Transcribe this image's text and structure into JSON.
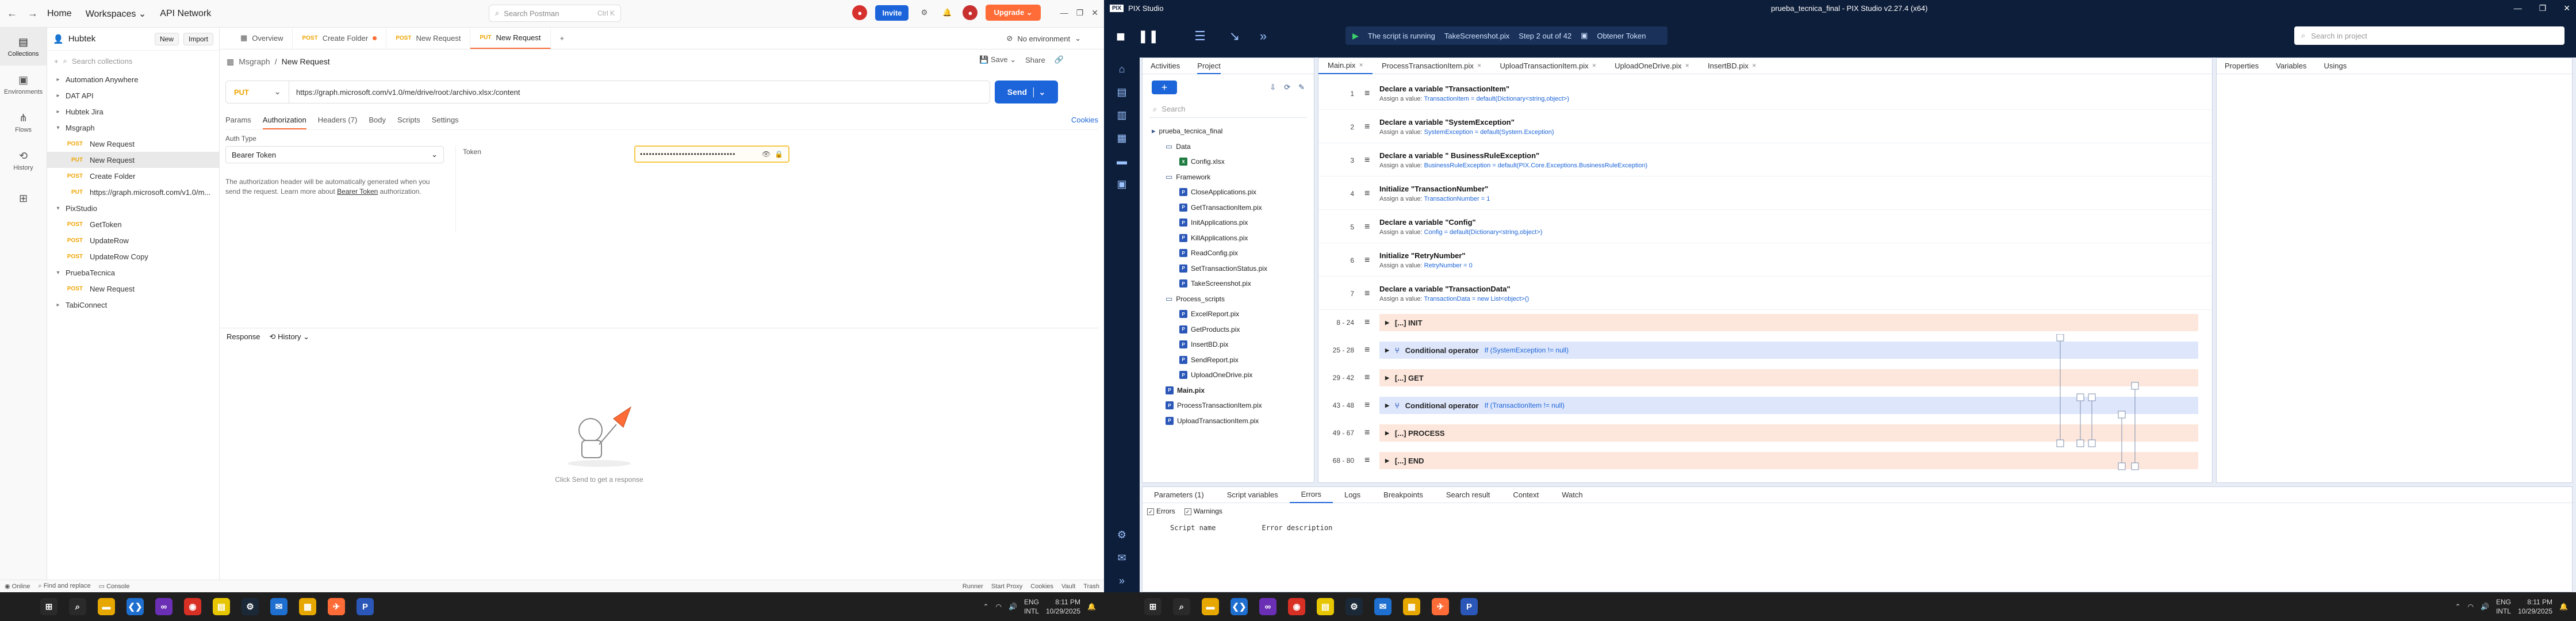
{
  "postman": {
    "topbar": {
      "home": "Home",
      "workspaces": "Workspaces",
      "api_network": "API Network",
      "search_placeholder": "Search Postman",
      "search_kbd": "Ctrl K",
      "invite": "Invite",
      "upgrade": "Upgrade"
    },
    "rail": [
      {
        "label": "Collections",
        "icon": "collections-icon"
      },
      {
        "label": "Environments",
        "icon": "environments-icon"
      },
      {
        "label": "Flows",
        "icon": "flows-icon"
      },
      {
        "label": "History",
        "icon": "history-icon"
      },
      {
        "label": "",
        "icon": "apps-icon"
      }
    ],
    "sidebar": {
      "workspace": "Hubtek",
      "new": "New",
      "import": "Import",
      "search_placeholder": "Search collections",
      "tree": [
        {
          "label": "Automation Anywhere",
          "level": 0,
          "type": "folder",
          "open": false
        },
        {
          "label": "DAT API",
          "level": 0,
          "type": "folder",
          "open": false
        },
        {
          "label": "Hubtek Jira",
          "level": 0,
          "type": "folder",
          "open": false
        },
        {
          "label": "Msgraph",
          "level": 0,
          "type": "folder",
          "open": true
        },
        {
          "label": "New Request",
          "level": 1,
          "type": "req",
          "method": "POST"
        },
        {
          "label": "New Request",
          "level": 1,
          "type": "req",
          "method": "PUT",
          "selected": true
        },
        {
          "label": "Create Folder",
          "level": 1,
          "type": "req",
          "method": "POST"
        },
        {
          "label": "https://graph.microsoft.com/v1.0/m...",
          "level": 1,
          "type": "req",
          "method": "PUT"
        },
        {
          "label": "PixStudio",
          "level": 0,
          "type": "folder",
          "open": true
        },
        {
          "label": "GetToken",
          "level": 1,
          "type": "req",
          "method": "POST"
        },
        {
          "label": "UpdateRow",
          "level": 1,
          "type": "req",
          "method": "POST"
        },
        {
          "label": "UpdateRow Copy",
          "level": 1,
          "type": "req",
          "method": "POST"
        },
        {
          "label": "PruebaTecnica",
          "level": 0,
          "type": "folder",
          "open": true
        },
        {
          "label": "New Request",
          "level": 1,
          "type": "req",
          "method": "POST"
        },
        {
          "label": "TabiConnect",
          "level": 0,
          "type": "folder",
          "open": false
        }
      ]
    },
    "tabs": [
      {
        "method": "",
        "label": "Overview"
      },
      {
        "method": "POST",
        "label": "Create Folder",
        "dot": true
      },
      {
        "method": "POST",
        "label": "New Request"
      },
      {
        "method": "PUT",
        "label": "New Request",
        "active": true
      }
    ],
    "env": "No environment",
    "breadcrumb": {
      "parent": "Msgraph",
      "current": "New Request"
    },
    "actions": {
      "save": "Save",
      "share": "Share"
    },
    "request": {
      "method": "PUT",
      "url": "https://graph.microsoft.com/v1.0/me/drive/root:/archivo.xlsx:/content",
      "send": "Send"
    },
    "req_tabs": [
      {
        "label": "Params"
      },
      {
        "label": "Authorization",
        "active": true
      },
      {
        "label": "Headers (7)"
      },
      {
        "label": "Body"
      },
      {
        "label": "Scripts"
      },
      {
        "label": "Settings"
      }
    ],
    "cookies": "Cookies",
    "auth": {
      "type_label": "Auth Type",
      "type_value": "Bearer Token",
      "help": "The authorization header will be automatically generated when you send the request. Learn more about ",
      "help_link": "Bearer Token",
      "help_end": " authorization.",
      "token_label": "Token",
      "token_value": "••••••••••••••••••••••••••••••••"
    },
    "response": {
      "label": "Response",
      "history": "History",
      "empty": "Click Send to get a response"
    },
    "statusbar": {
      "left": [
        "Online",
        "Find and replace",
        "Console"
      ],
      "right": [
        "Runner",
        "Start Proxy",
        "Cookies",
        "Vault",
        "Trash"
      ]
    }
  },
  "pix": {
    "title": "prueba_tecnica_final - PIX Studio v2.27.4 (x64)",
    "app_name": "PIX Studio",
    "run": {
      "status": "The script is running",
      "file": "TakeScreenshot.pix",
      "step": "Step 2 out of 42",
      "activity": "Obtener Token"
    },
    "search_placeholder": "Search in project",
    "project_tabs": [
      {
        "label": "Activities"
      },
      {
        "label": "Project",
        "active": true
      }
    ],
    "project_search": "Search",
    "project_tree": [
      {
        "label": "prueba_tecnica_final",
        "level": 0,
        "kind": "root"
      },
      {
        "label": "Data",
        "level": 1,
        "kind": "folder"
      },
      {
        "label": "Config.xlsx",
        "level": 2,
        "kind": "xls"
      },
      {
        "label": "Framework",
        "level": 1,
        "kind": "folder"
      },
      {
        "label": "CloseApplications.pix",
        "level": 2,
        "kind": "pix"
      },
      {
        "label": "GetTransactionItem.pix",
        "level": 2,
        "kind": "pix"
      },
      {
        "label": "InitApplications.pix",
        "level": 2,
        "kind": "pix"
      },
      {
        "label": "KillApplications.pix",
        "level": 2,
        "kind": "pix"
      },
      {
        "label": "ReadConfig.pix",
        "level": 2,
        "kind": "pix"
      },
      {
        "label": "SetTransactionStatus.pix",
        "level": 2,
        "kind": "pix"
      },
      {
        "label": "TakeScreenshot.pix",
        "level": 2,
        "kind": "pix"
      },
      {
        "label": "Process_scripts",
        "level": 1,
        "kind": "folder"
      },
      {
        "label": "ExcelReport.pix",
        "level": 2,
        "kind": "pix"
      },
      {
        "label": "GetProducts.pix",
        "level": 2,
        "kind": "pix"
      },
      {
        "label": "InsertBD.pix",
        "level": 2,
        "kind": "pix"
      },
      {
        "label": "SendReport.pix",
        "level": 2,
        "kind": "pix"
      },
      {
        "label": "UploadOneDrive.pix",
        "level": 2,
        "kind": "pix"
      },
      {
        "label": "Main.pix",
        "level": 1,
        "kind": "pix",
        "bold": true
      },
      {
        "label": "ProcessTransactionItem.pix",
        "level": 1,
        "kind": "pix"
      },
      {
        "label": "UploadTransactionItem.pix",
        "level": 1,
        "kind": "pix"
      }
    ],
    "editor_tabs": [
      {
        "label": "Main.pix",
        "active": true
      },
      {
        "label": "ProcessTransactionItem.pix"
      },
      {
        "label": "UploadTransactionItem.pix"
      },
      {
        "label": "UploadOneDrive.pix"
      },
      {
        "label": "InsertBD.pix"
      }
    ],
    "sequence": [
      {
        "kind": "var",
        "line": "1",
        "title": "Declare a variable \"TransactionItem\"",
        "prefix": "Assign a value: ",
        "value": "TransactionItem = default(Dictionary<string,object>)"
      },
      {
        "kind": "var",
        "line": "2",
        "title": "Declare a variable \"SystemException\"",
        "prefix": "Assign a value: ",
        "value": "SystemException = default(System.Exception)"
      },
      {
        "kind": "var",
        "line": "3",
        "title": "Declare a variable \" BusinessRuleException\"",
        "prefix": "Assign a value: ",
        "value": "BusinessRuleException = default(PIX.Core.Exceptions.BusinessRuleException)"
      },
      {
        "kind": "var",
        "line": "4",
        "title": "Initialize \"TransactionNumber\"",
        "prefix": "Assign a value: ",
        "value": "TransactionNumber = 1"
      },
      {
        "kind": "var",
        "line": "5",
        "title": "Declare a variable \"Config\"",
        "prefix": "Assign a value: ",
        "value": "Config = default(Dictionary<string,object>)"
      },
      {
        "kind": "var",
        "line": "6",
        "title": "Initialize \"RetryNumber\"",
        "prefix": "Assign a value: ",
        "value": "RetryNumber = 0"
      },
      {
        "kind": "var",
        "line": "7",
        "title": "Declare a variable \"TransactionData\"",
        "prefix": "Assign a value: ",
        "value": "TransactionData = new List<object>()"
      },
      {
        "kind": "region",
        "line": "8 - 24",
        "title": "[...] INIT",
        "color": "orange"
      },
      {
        "kind": "cond",
        "line": "25 - 28",
        "title": "Conditional operator",
        "cond": "If (SystemException != null)",
        "color": "blue"
      },
      {
        "kind": "region",
        "line": "29 - 42",
        "title": "[...] GET",
        "color": "orange"
      },
      {
        "kind": "cond",
        "line": "43 - 48",
        "title": "Conditional operator",
        "cond": "If (TransactionItem != null)",
        "color": "blue"
      },
      {
        "kind": "region",
        "line": "49 - 67",
        "title": "[...] PROCESS",
        "color": "orange"
      },
      {
        "kind": "region",
        "line": "68 - 80",
        "title": "[...] END",
        "color": "orange"
      }
    ],
    "props_tabs": [
      {
        "label": "Properties"
      },
      {
        "label": "Variables"
      },
      {
        "label": "Usings"
      }
    ],
    "bottom_tabs": [
      {
        "label": "Parameters (1)"
      },
      {
        "label": "Script variables"
      },
      {
        "label": "Errors",
        "active": true
      },
      {
        "label": "Logs"
      },
      {
        "label": "Breakpoints"
      },
      {
        "label": "Search result"
      },
      {
        "label": "Context"
      },
      {
        "label": "Watch"
      }
    ],
    "filters": {
      "errors": "Errors",
      "warnings": "Warnings"
    },
    "columns": {
      "name": "Script name",
      "desc": "Error description"
    }
  },
  "taskbar": {
    "lang": "ENG",
    "layout": "INTL",
    "time": "8:11 PM",
    "date": "10/29/2025"
  },
  "colors": {
    "postman_orange": "#ff6c37",
    "postman_blue": "#1c64d9",
    "pix_navy": "#0d1e3a",
    "region_orange": "#fde7dc",
    "region_blue": "#dde6fb"
  }
}
